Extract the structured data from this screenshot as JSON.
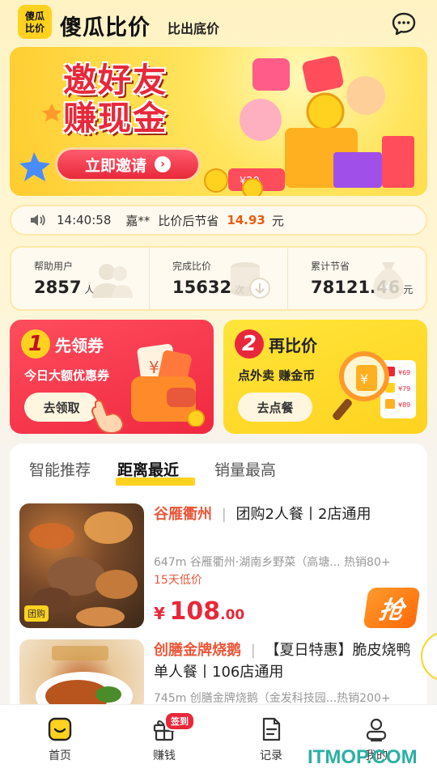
{
  "header": {
    "logo_line1": "傻瓜",
    "logo_line2": "比价",
    "brand": "傻瓜比价",
    "slogan": "比出底价",
    "chat_icon": "chat-bubble-icon"
  },
  "banner": {
    "line1": "邀好友",
    "line2": "赚现金",
    "invite_label": "立即邀请"
  },
  "ticker": {
    "time": "14:40:58",
    "user": "嘉**",
    "text": "比价后节省",
    "amount": "14.93",
    "unit": "元"
  },
  "stats": [
    {
      "label": "帮助用户",
      "value": "2857",
      "unit": "人",
      "icon": "users-icon"
    },
    {
      "label": "完成比价",
      "value": "15632",
      "unit": "次",
      "icon": "database-icon"
    },
    {
      "label": "累计节省",
      "value": "78121.46",
      "unit": "元",
      "icon": "money-bag-icon"
    }
  ],
  "promo": [
    {
      "num": "1",
      "title": "先领券",
      "sub": "今日大额优惠券",
      "button": "去领取"
    },
    {
      "num": "2",
      "title": "再比价",
      "sub": "点外卖 赚金币",
      "button": "去点餐"
    }
  ],
  "tabs": [
    "智能推荐",
    "距离最近",
    "销量最高"
  ],
  "items": [
    {
      "shop": "谷雁衢州",
      "title_rest": "团购2人餐丨2店通用",
      "meta": "647m 谷雁衢州·湖南乡野菜（高塘... 热销80+",
      "badge": "15天低价",
      "tag": "团购",
      "currency": "¥",
      "price_int": "108",
      "price_dec": ".00",
      "grab": "抢"
    },
    {
      "shop": "创膳金牌烧鹅",
      "title_rest": "【夏日特惠】脆皮烧鸭单人餐丨106店通用",
      "meta": "745m 创膳金牌烧鹅（金发科技园...热销200+"
    }
  ],
  "nav": [
    {
      "label": "首页",
      "icon": "home-icon"
    },
    {
      "label": "赚钱",
      "icon": "gift-icon",
      "badge": "签到"
    },
    {
      "label": "记录",
      "icon": "document-icon"
    },
    {
      "label": "我的",
      "icon": "profile-icon"
    }
  ],
  "watermark": "ITMOP.COM"
}
